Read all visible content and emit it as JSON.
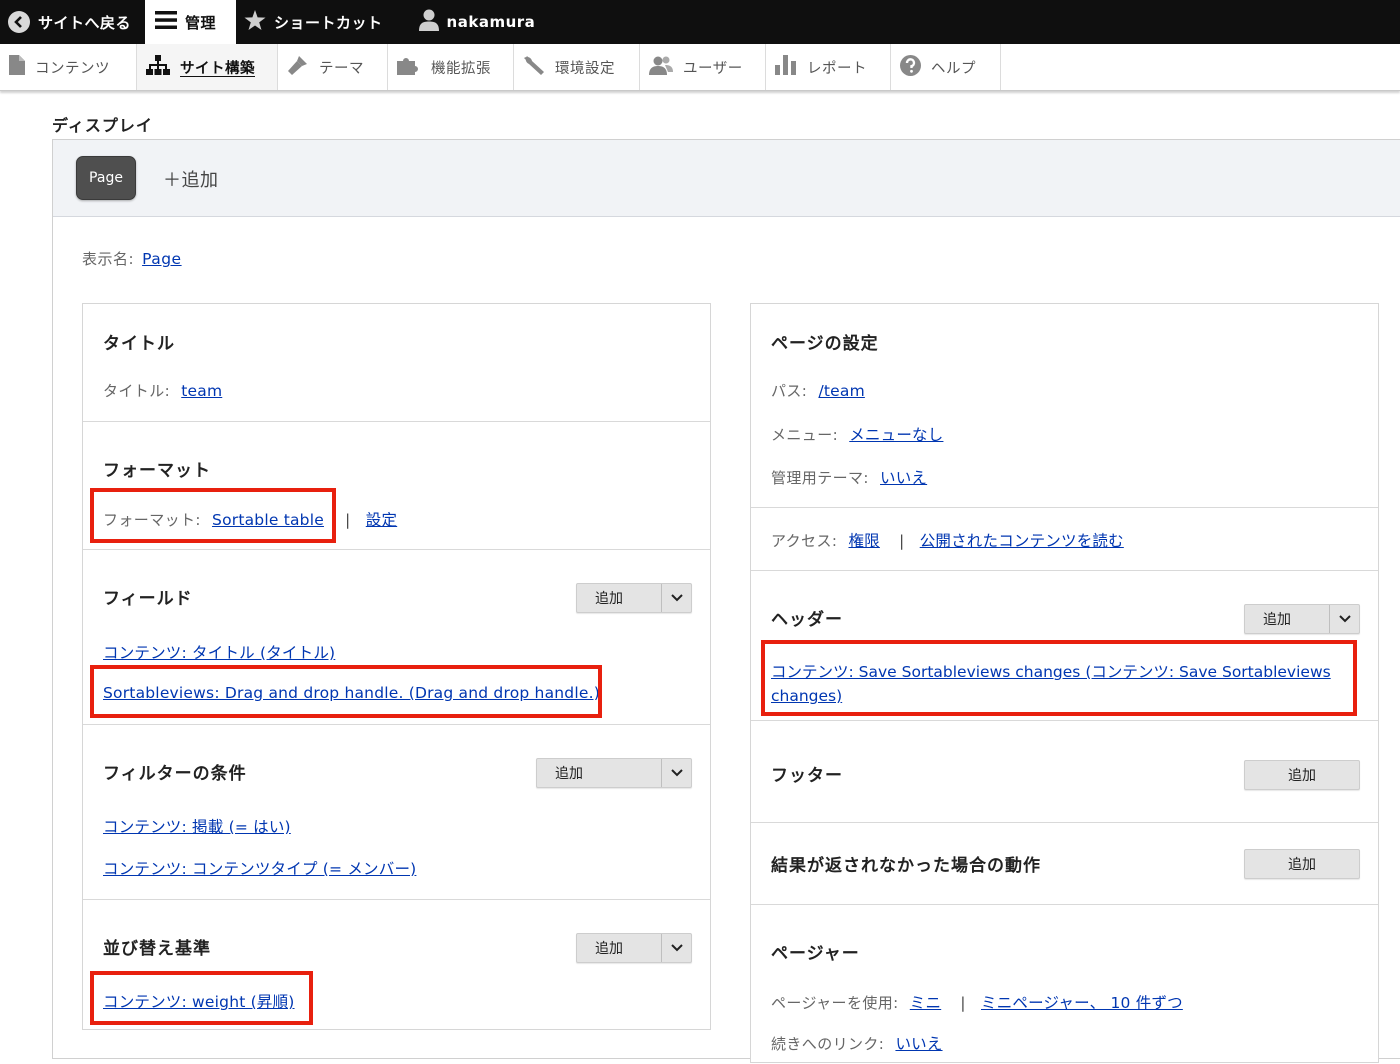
{
  "toolbar": {
    "back": "サイトへ戻る",
    "manage": "管理",
    "shortcuts": "ショートカット",
    "user": "nakamura"
  },
  "tray": {
    "content": "コンテンツ",
    "structure": "サイト構築",
    "appearance": "テーマ",
    "extend": "機能拡張",
    "config": "環境設定",
    "people": "ユーザー",
    "reports": "レポート",
    "help": "ヘルプ"
  },
  "page_title": "ディスプレイ",
  "display": {
    "tab": "Page",
    "add": "＋追加",
    "name_label": "表示名:",
    "name_value": "Page"
  },
  "left": {
    "title_sec": {
      "heading": "タイトル",
      "label": "タイトル:",
      "value": "team"
    },
    "format_sec": {
      "heading": "フォーマット",
      "label": "フォーマット:",
      "value": "Sortable table",
      "sep": "|",
      "settings": "設定"
    },
    "fields_sec": {
      "heading": "フィールド",
      "add": "追加",
      "items": [
        "コンテンツ: タイトル (タイトル)",
        "Sortableviews: Drag and drop handle. (Drag and drop handle.)"
      ]
    },
    "filter_sec": {
      "heading": "フィルターの条件",
      "add": "追加",
      "items": [
        "コンテンツ: 掲載 (= はい)",
        "コンテンツ: コンテンツタイプ (= メンバー)"
      ]
    },
    "sort_sec": {
      "heading": "並び替え基準",
      "add": "追加",
      "items": [
        "コンテンツ: weight (昇順)"
      ]
    }
  },
  "right": {
    "page_settings": {
      "heading": "ページの設定",
      "path_label": "パス:",
      "path_value": "/team",
      "menu_label": "メニュー:",
      "menu_value": "メニューなし",
      "admin_theme_label": "管理用テーマ:",
      "admin_theme_value": "いいえ"
    },
    "access": {
      "label": "アクセス:",
      "value1": "権限",
      "sep": "|",
      "value2": "公開されたコンテンツを読む"
    },
    "header_sec": {
      "heading": "ヘッダー",
      "add": "追加",
      "item_line1": "コンテンツ: Save Sortableviews changes (コンテンツ: Save Sortableviews",
      "item_line2": "changes)"
    },
    "footer_sec": {
      "heading": "フッター",
      "add": "追加"
    },
    "no_results_sec": {
      "heading": "結果が返されなかった場合の動作",
      "add": "追加"
    },
    "pager_sec": {
      "heading": "ページャー",
      "use_label": "ページャーを使用:",
      "use_value1": "ミニ",
      "sep": "|",
      "use_value2": "ミニページャー、 10 件ずつ",
      "more_label": "続きへのリンク:",
      "more_value": "いいえ"
    }
  },
  "colors": {
    "highlight": "#e8200e",
    "link": "#0036b1",
    "toolbar": "#0f0f0f"
  }
}
